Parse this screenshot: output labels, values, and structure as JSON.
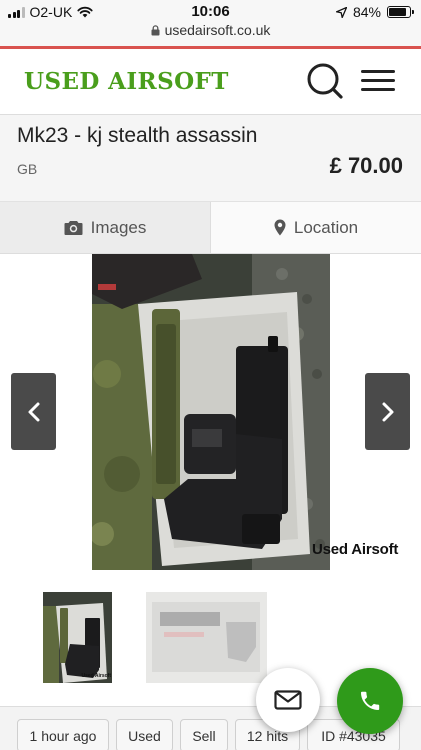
{
  "status_bar": {
    "carrier": "O2-UK",
    "time": "10:06",
    "battery": "84%",
    "battery_level": 0.84
  },
  "browser": {
    "url": "usedairsoft.co.uk"
  },
  "header": {
    "logo_text": "USED AIRSOFT",
    "logo_color": "#4a9e1c",
    "search_icon": "search-icon",
    "menu_icon": "hamburger-menu-icon"
  },
  "listing": {
    "title": "Mk23 - kj stealth assassin",
    "region": "GB",
    "price": "£ 70.00"
  },
  "tabs": [
    {
      "label": "Images",
      "icon": "camera-icon",
      "active": true
    },
    {
      "label": "Location",
      "icon": "map-pin-icon",
      "active": false
    }
  ],
  "gallery": {
    "watermark": "Used Airsoft",
    "thumb_watermark": "Used Airsoft",
    "prev_icon": "chevron-left-icon",
    "next_icon": "chevron-right-icon"
  },
  "meta": {
    "posted": "1 hour ago",
    "condition": "Used",
    "type": "Sell",
    "hits": "12 hits",
    "id": "ID #43035"
  },
  "actions": {
    "mail_icon": "envelope-icon",
    "call_icon": "phone-icon",
    "call_color": "#2f9a1a"
  }
}
